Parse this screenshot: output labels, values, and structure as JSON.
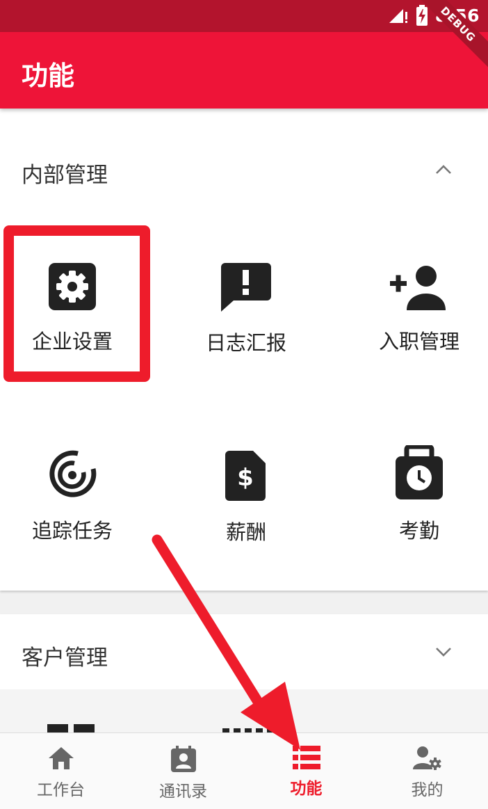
{
  "status_bar": {
    "time": "8:56"
  },
  "debug_banner": "DEBUG",
  "app_bar": {
    "title": "功能"
  },
  "sections": [
    {
      "title": "内部管理",
      "expanded": true,
      "items": [
        {
          "label": "企业设置",
          "icon": "settings-icon"
        },
        {
          "label": "日志汇报",
          "icon": "feedback-icon"
        },
        {
          "label": "入职管理",
          "icon": "person-add-icon"
        },
        {
          "label": "追踪任务",
          "icon": "track-icon"
        },
        {
          "label": "薪酬",
          "icon": "salary-icon"
        },
        {
          "label": "考勤",
          "icon": "attendance-icon"
        }
      ]
    },
    {
      "title": "客户管理",
      "expanded": false
    }
  ],
  "bottom_nav": [
    {
      "label": "工作台",
      "icon": "home-icon",
      "active": false
    },
    {
      "label": "通讯录",
      "icon": "contacts-icon",
      "active": false
    },
    {
      "label": "功能",
      "icon": "list-icon",
      "active": true
    },
    {
      "label": "我的",
      "icon": "user-settings-icon",
      "active": false
    }
  ],
  "colors": {
    "primary": "#ee1438",
    "status_bar": "#b3142d",
    "highlight": "#ee1c2b",
    "active_nav": "#ee1c2b",
    "inactive_nav": "#666666"
  }
}
